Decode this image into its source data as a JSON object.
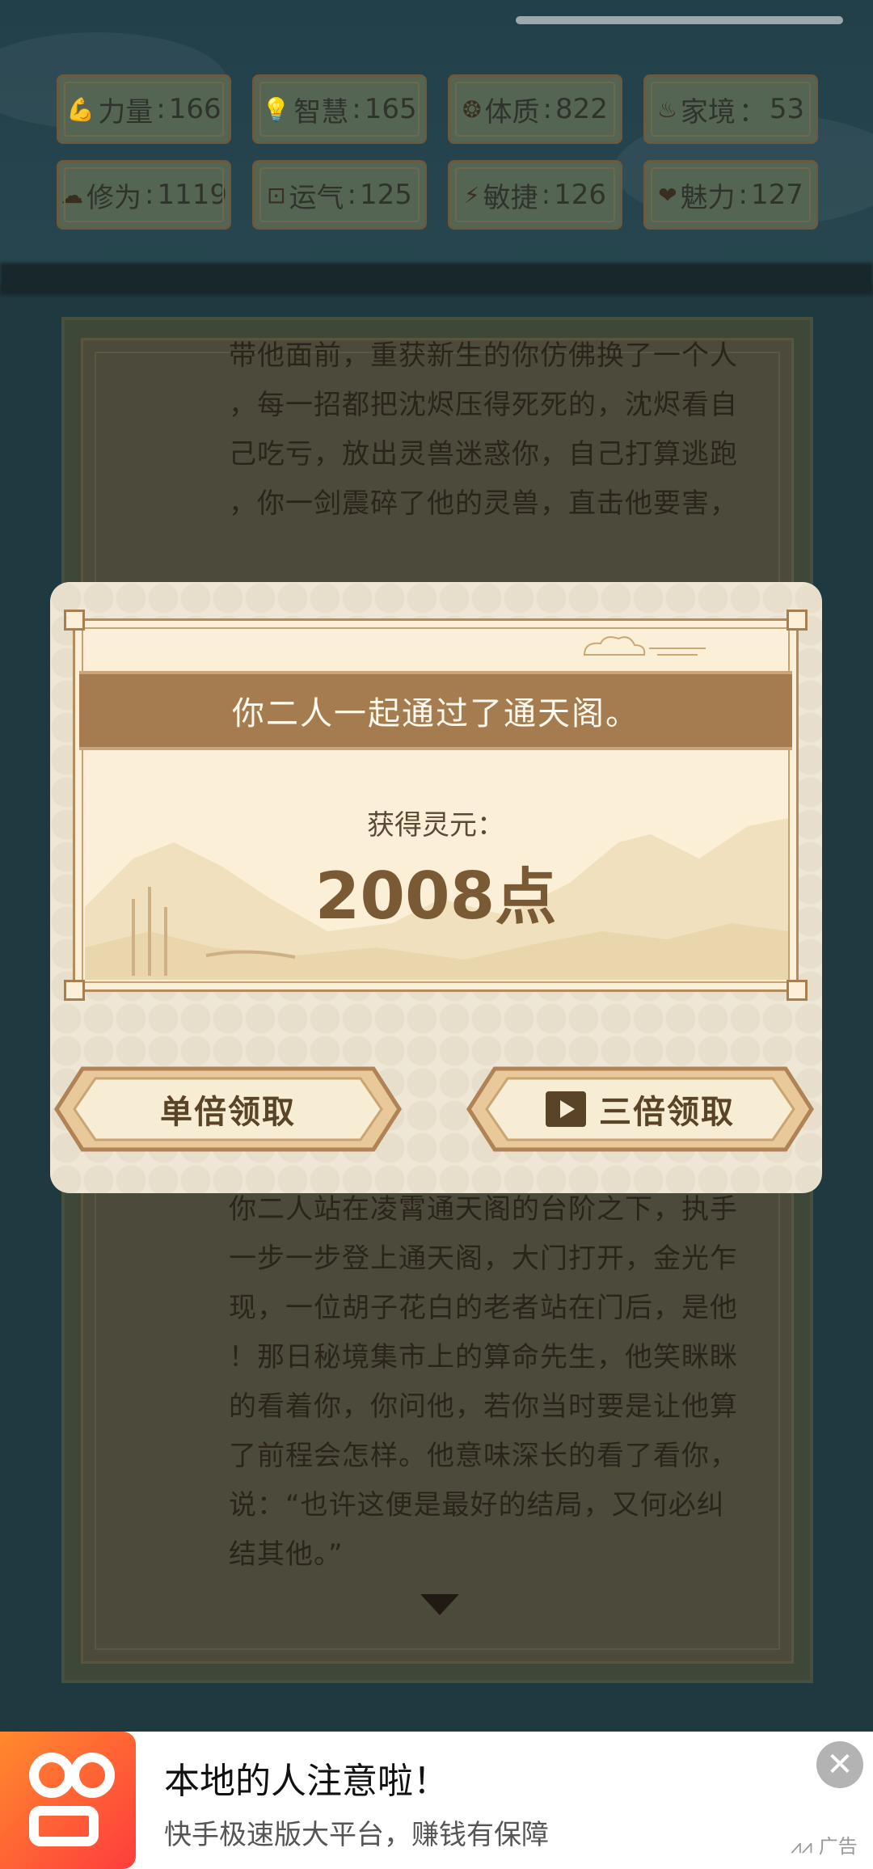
{
  "stats": [
    {
      "icon": "strength-icon",
      "glyph": "💪",
      "label": "力量",
      "value": "166"
    },
    {
      "icon": "wisdom-icon",
      "glyph": "💡",
      "label": "智慧",
      "value": "165"
    },
    {
      "icon": "constitution-icon",
      "glyph": "❂",
      "label": "体质",
      "value": "822"
    },
    {
      "icon": "family-icon",
      "glyph": "♨",
      "label": "家境",
      "value": "53"
    },
    {
      "icon": "cultivation-icon",
      "glyph": "☁",
      "label": "修为",
      "value": "1119"
    },
    {
      "icon": "luck-icon",
      "glyph": "⊡",
      "label": "运气",
      "value": "125"
    },
    {
      "icon": "agility-icon",
      "glyph": "⚡",
      "label": "敏捷",
      "value": "126"
    },
    {
      "icon": "charm-icon",
      "glyph": "❤",
      "label": "魅力",
      "value": "127"
    }
  ],
  "story_top": [
    "带他面前，重获新生的你仿佛换了一个人",
    "，每一招都把沈烬压得死死的，沈烬看自",
    "己吃亏，放出灵兽迷惑你，自己打算逃跑",
    "，你一剑震碎了他的灵兽，直击他要害，"
  ],
  "story_bottom": [
    "你二人站在凌霄通天阁的台阶之下，执手",
    "一步一步登上通天阁，大门打开，金光乍",
    "现，一位胡子花白的老者站在门后，是他",
    "！那日秘境集市上的算命先生，他笑眯眯",
    "的看着你，你问他，若你当时要是让他算",
    "了前程会怎样。他意味深长的看了看你，",
    "说：“也许这便是最好的结局，又何必纠",
    "结其他。”"
  ],
  "dialog": {
    "message": "你二人一起通过了通天阁。",
    "reward_label": "获得灵元：",
    "reward_amount": "2008",
    "reward_unit": "点",
    "single_button": "单倍领取",
    "triple_button": "三倍领取"
  },
  "ad": {
    "title": "本地的人注意啦！",
    "subtitle": "快手极速版大平台，赚钱有保障",
    "tag": "广告",
    "close": "✕"
  },
  "colors": {
    "banner": "#a57c4f",
    "dialog_bg": "#eee7d6",
    "frame_border": "#b48b5a",
    "ad_brand": "#ff5a2c"
  }
}
